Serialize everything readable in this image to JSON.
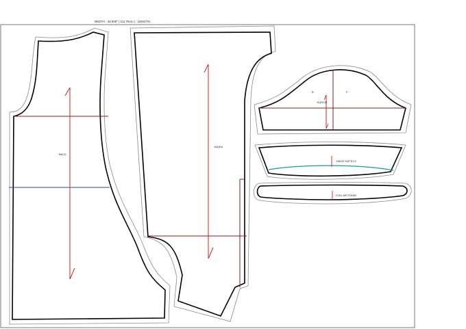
{
  "header": {
    "dimension_text": "WIDTH : 44.000\" | 111.76cm | : LENGTH"
  },
  "pieces": {
    "back": {
      "label": "BACK"
    },
    "front": {
      "label": "JAQKA"
    },
    "sleeve": {
      "label": "SLEEVE",
      "mark_back": "B",
      "mark_front": "F"
    },
    "collar_top": {
      "label": "YAKAT KAT'EC3"
    },
    "collar_stand": {
      "label": "COLLAR STAND"
    }
  },
  "colors": {
    "outline": "#000000",
    "seam_allowance": "#888888",
    "grainline": "#cc2222",
    "guide_line": "#8b1a1a",
    "blue_line": "#3344aa",
    "teal_line": "#1a9a9a"
  }
}
